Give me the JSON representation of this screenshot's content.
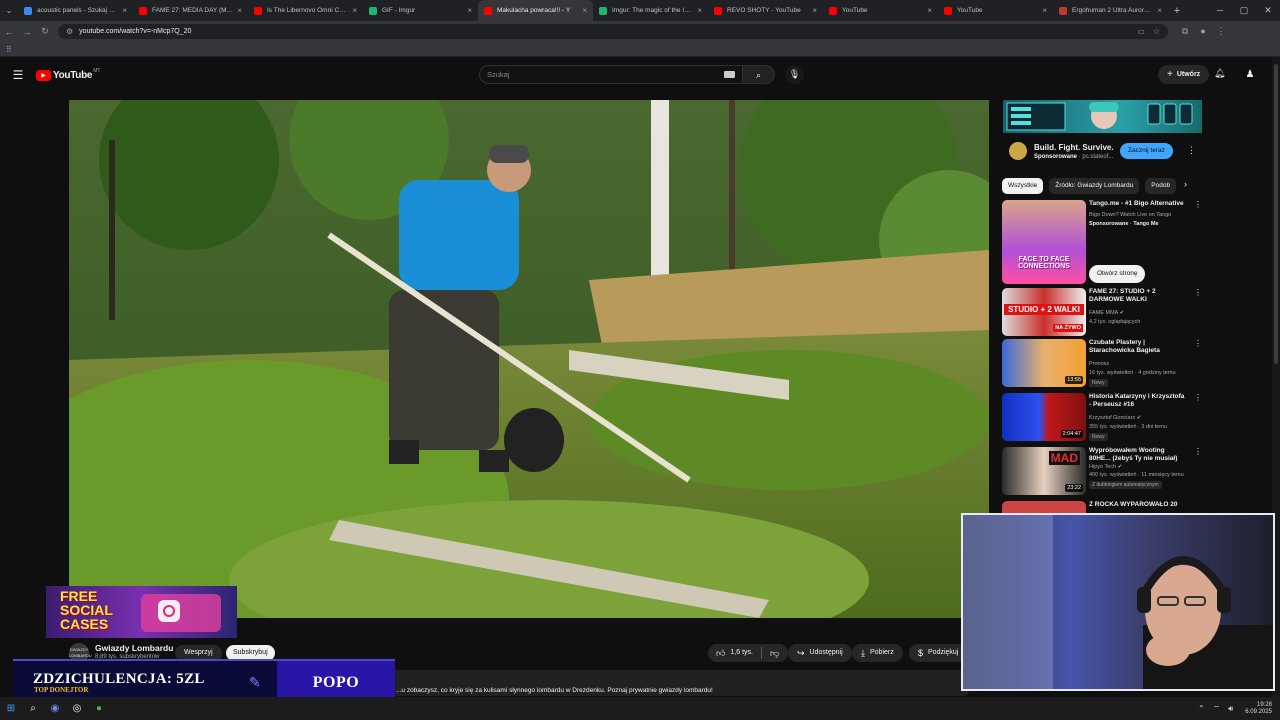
{
  "browser": {
    "tabs": [
      {
        "title": "acoustic panels - Szukaj w Go",
        "icon": "google-icon",
        "color": "#4285f4"
      },
      {
        "title": "FAME 27: MEDIA DAY (Media",
        "icon": "youtube-icon",
        "color": "#ff0000"
      },
      {
        "title": "Is The Libernovo Omni Chair",
        "icon": "youtube-icon",
        "color": "#ff0000"
      },
      {
        "title": "GIF - Imgur",
        "icon": "imgur-icon",
        "color": "#1bb76e"
      },
      {
        "title": "Makulacha powraca!!! - Y",
        "icon": "youtube-icon",
        "color": "#ff0000",
        "active": true
      },
      {
        "title": "Imgur: The magic of the Inter",
        "icon": "imgur-icon",
        "color": "#1bb76e"
      },
      {
        "title": "REVO SHOTY - YouTube",
        "icon": "youtube-icon",
        "color": "#ff0000"
      },
      {
        "title": "YouTube",
        "icon": "youtube-icon",
        "color": "#ff0000"
      },
      {
        "title": "YouTube",
        "icon": "youtube-icon",
        "color": "#ff0000"
      },
      {
        "title": "Ergohuman 2 Ultra Aurora W",
        "icon": "page-icon",
        "color": "#c0392b"
      }
    ],
    "url": "youtube.com/watch?v=-nMcp7Q_20"
  },
  "youtube": {
    "logo": "YouTube",
    "logo_suffix": "MT",
    "search_placeholder": "Szukaj",
    "create_label": "Utwórz"
  },
  "ad": {
    "title": "Build. Fight. Survive.",
    "sponsored": "Sponsorowane",
    "advertiser": "pc.stateof...",
    "cta": "Zacznij teraz"
  },
  "chips": [
    "Wszystkie",
    "Źródło: Gwiazdy Lombardu",
    "Podob"
  ],
  "recommendations": [
    {
      "title": "Tango.me - #1 Bigo Alternative",
      "channel": "Bigo Down? Watch Live on Tango",
      "meta": "Sponsorowane · Tango Me",
      "thumb_text": "FACE TO FACE CONNECTIONS",
      "cta": "Otwórz stronę"
    },
    {
      "title": "FAME 27: STUDIO + 2 DARMOWE WALKI",
      "channel": "FAME MMA",
      "meta": "4,2 tys. oglądających",
      "thumb_text": "STUDIO + 2 WALKI",
      "thumb_badge": "NA ŻYWO"
    },
    {
      "title": "Czubate Plastery | Starachowicka Bagieta",
      "channel": "Pronosz",
      "meta": "16 tys. wyświetleń · 4 godziny temu",
      "badge": "Nowy",
      "duration": "13:55"
    },
    {
      "title": "Historia Katarzyny i Krzysztofa - Perseusz #16",
      "channel": "Krzysztof Gonciarz",
      "meta": "355 tys. wyświetleń · 3 dni temu",
      "badge": "Nowy",
      "duration": "2:04:47"
    },
    {
      "title": "Wypróbowałem Wooting 80HE... (żebyś Ty nie musiał)",
      "channel": "Hipyo Tech",
      "meta": "400 tys. wyświetleń · 11 miesięcy temu",
      "badge": "Z dubbingiem automatycznym",
      "duration": "23:22",
      "thumb_text": "MAD"
    },
    {
      "title": "Z ROCKA WYPAROWAŁO 20"
    }
  ],
  "video_page": {
    "channel": "Gwiazdy Lombardu",
    "subscribers": "8,89 tys. subskrybentów",
    "support": "Wesprzyj",
    "subscribe": "Subskrybuj",
    "likes": "1,6 tys.",
    "share": "Udostępnij",
    "download": "Pobierz",
    "thanks": "Podziękuj",
    "description": "...u zobaczysz, co kryje się za kulisami słynnego lombardu w Drezdenku. Poznaj prywatnie gwiazdy lombardu!"
  },
  "overlays": {
    "promo": "FREE SOCIAL CASES",
    "donation_amount": "ZDZICHULENCJA: 5ZL",
    "donation_label": "TOP DONEJTOR",
    "donor_name": "POPO"
  },
  "taskbar": {
    "time": "19:28",
    "date": "6.09.2025"
  }
}
